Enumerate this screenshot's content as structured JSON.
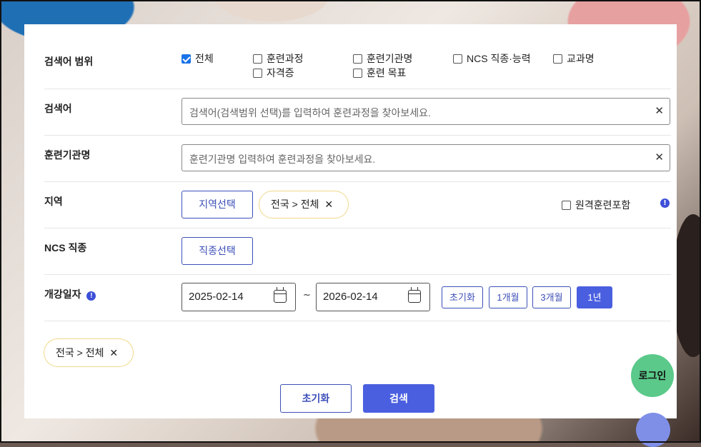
{
  "scope": {
    "label": "검색어 범위",
    "options": [
      {
        "label": "전체",
        "checked": true
      },
      {
        "label": "훈련과정",
        "checked": false
      },
      {
        "label": "훈련기관명",
        "checked": false
      },
      {
        "label": "NCS 직종·능력",
        "checked": false
      },
      {
        "label": "교과명",
        "checked": false
      },
      {
        "label": "자격증",
        "checked": false
      },
      {
        "label": "훈련 목표",
        "checked": false
      }
    ]
  },
  "keyword": {
    "label": "검색어",
    "placeholder": "검색어(검색범위 선택)를 입력하여 훈련과정을 찾아보세요.",
    "clear": "✕"
  },
  "institution": {
    "label": "훈련기관명",
    "placeholder": "훈련기관명 입력하여 훈련과정을 찾아보세요.",
    "clear": "✕"
  },
  "region": {
    "label": "지역",
    "select_button": "지역선택",
    "chip": "전국 > 전체",
    "remote_label": "원격훈련포함",
    "remote_checked": false,
    "info": "!"
  },
  "ncs": {
    "label": "NCS 직종",
    "select_button": "직종선택"
  },
  "start_date": {
    "label": "개강일자",
    "info": "!",
    "from": "2025-02-14",
    "separator": "~",
    "to": "2026-02-14",
    "buttons": [
      {
        "label": "초기화",
        "active": false
      },
      {
        "label": "1개월",
        "active": false
      },
      {
        "label": "3개월",
        "active": false
      },
      {
        "label": "1년",
        "active": true
      }
    ]
  },
  "selected": {
    "chip": "전국 > 전체"
  },
  "actions": {
    "reset": "초기화",
    "search": "검색"
  },
  "floating": {
    "login": "로그인"
  },
  "colors": {
    "accent": "#4a5fe0",
    "checkbox": "#1a73e8",
    "chip_border": "#efd98a",
    "login_bg": "#5ac98a"
  }
}
